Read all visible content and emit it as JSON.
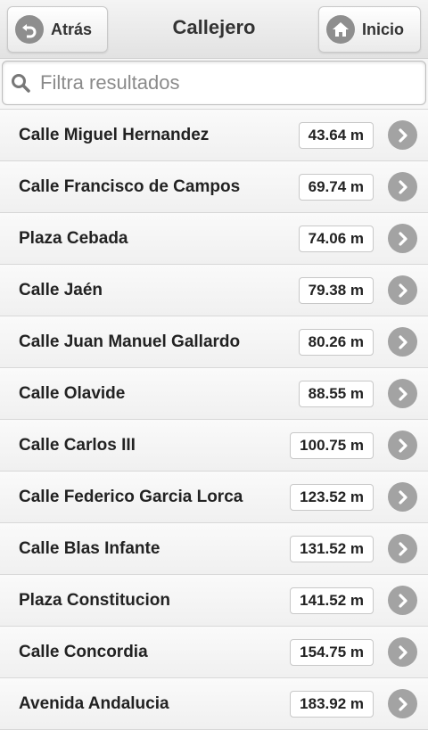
{
  "header": {
    "back_label": "Atrás",
    "title": "Callejero",
    "home_label": "Inicio"
  },
  "search": {
    "placeholder": "Filtra resultados",
    "value": ""
  },
  "streets": [
    {
      "name": "Calle Miguel Hernandez",
      "distance": "43.64 m"
    },
    {
      "name": "Calle Francisco de Campos",
      "distance": "69.74 m"
    },
    {
      "name": "Plaza Cebada",
      "distance": "74.06 m"
    },
    {
      "name": "Calle Jaén",
      "distance": "79.38 m"
    },
    {
      "name": "Calle Juan Manuel Gallardo",
      "distance": "80.26 m"
    },
    {
      "name": "Calle Olavide",
      "distance": "88.55 m"
    },
    {
      "name": "Calle Carlos III",
      "distance": "100.75 m"
    },
    {
      "name": "Calle Federico Garcia Lorca",
      "distance": "123.52 m"
    },
    {
      "name": "Calle Blas Infante",
      "distance": "131.52 m"
    },
    {
      "name": "Plaza Constitucion",
      "distance": "141.52 m"
    },
    {
      "name": "Calle Concordia",
      "distance": "154.75 m"
    },
    {
      "name": "Avenida Andalucia",
      "distance": "183.92 m"
    }
  ],
  "icons": {
    "back": "back-arrow-icon",
    "home": "home-icon",
    "search": "search-icon",
    "row": "chevron-right-icon"
  },
  "colors": {
    "icon_gray": "#8e8e8e",
    "chevron_gray": "#a3a3a3"
  }
}
